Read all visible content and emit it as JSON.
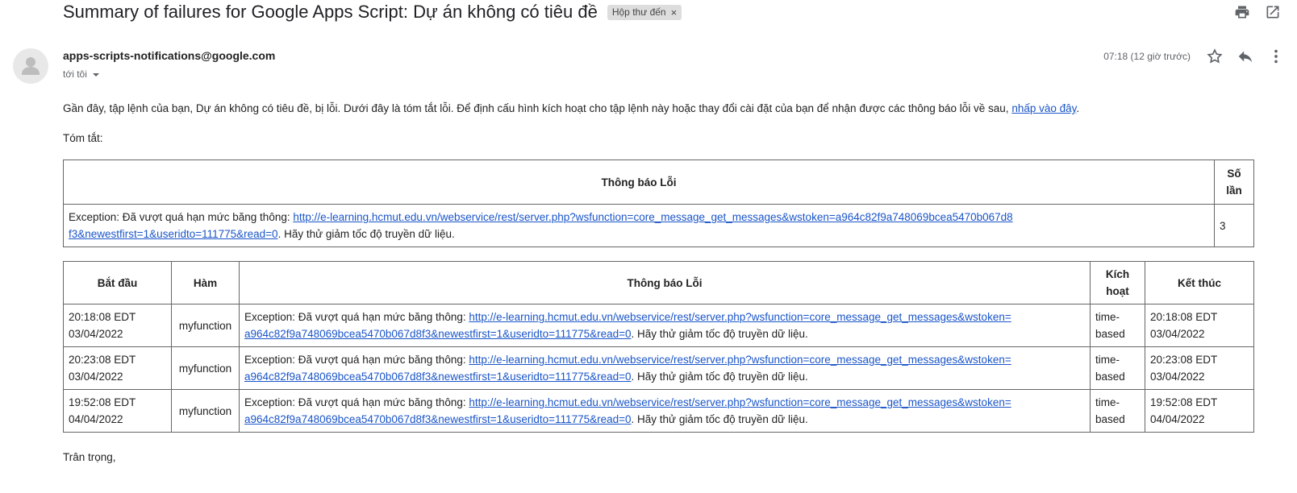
{
  "email": {
    "subject": "Summary of failures for Google Apps Script: Dự án không có tiêu đề",
    "label": "Hộp thư đến",
    "label_remove": "×",
    "sender": "apps-scripts-notifications@google.com",
    "recipient": "tới tôi",
    "time": "07:18 (12 giờ trước)",
    "icons": {
      "print": "print-icon",
      "new_window": "open-in-new-window-icon",
      "star": "star-icon",
      "reply": "reply-icon",
      "more": "more-vert-icon",
      "avatar": "person-icon"
    }
  },
  "body": {
    "intro_text": "Gần đây, tập lệnh của bạn, Dự án không có tiêu đề, bị lỗi. Dưới đây là tóm tắt lỗi. Để định cấu hình kích hoạt cho tập lệnh này hoặc thay đổi cài đặt của bạn để nhận được các thông báo lỗi về sau, ",
    "intro_link": "nhấp vào đây",
    "intro_end": ".",
    "summary_label": "Tóm tắt:",
    "closing": "Trân trọng,"
  },
  "summary_table": {
    "headers": {
      "message": "Thông báo Lỗi",
      "count": "Số lần"
    },
    "rows": [
      {
        "message_prefix": "Exception: Đã vượt quá hạn mức băng thông: ",
        "url_line1": "http://e-learning.hcmut.edu.vn/webservice/rest/server.php?wsfunction=core_message_get_messages&wstoken=a964c82f9a748069bcea5470b067d8",
        "url_line2": "f3&newestfirst=1&useridto=111775&read=0",
        "message_suffix": ". Hãy thử giảm tốc độ truyền dữ liệu.",
        "count": "3"
      }
    ]
  },
  "detail_table": {
    "headers": {
      "start": "Bắt đầu",
      "function": "Hàm",
      "message": "Thông báo Lỗi",
      "trigger": "Kích hoạt",
      "end": "Kết thúc"
    },
    "rows": [
      {
        "start": "20:18:08 EDT 03/04/2022",
        "function": "myfunction",
        "message_prefix": "Exception: Đã vượt quá hạn mức băng thông: ",
        "url_line1": "http://e-learning.hcmut.edu.vn/webservice/rest/server.php?wsfunction=core_message_get_messages&wstoken=",
        "url_line2": "a964c82f9a748069bcea5470b067d8f3&newestfirst=1&useridto=111775&read=0",
        "message_suffix": ". Hãy thử giảm tốc độ truyền dữ liệu.",
        "trigger": "time-based",
        "end": "20:18:08 EDT 03/04/2022"
      },
      {
        "start": "20:23:08 EDT 03/04/2022",
        "function": "myfunction",
        "message_prefix": "Exception: Đã vượt quá hạn mức băng thông: ",
        "url_line1": "http://e-learning.hcmut.edu.vn/webservice/rest/server.php?wsfunction=core_message_get_messages&wstoken=",
        "url_line2": "a964c82f9a748069bcea5470b067d8f3&newestfirst=1&useridto=111775&read=0",
        "message_suffix": ". Hãy thử giảm tốc độ truyền dữ liệu.",
        "trigger": "time-based",
        "end": "20:23:08 EDT 03/04/2022"
      },
      {
        "start": "19:52:08 EDT 04/04/2022",
        "function": "myfunction",
        "message_prefix": "Exception: Đã vượt quá hạn mức băng thông: ",
        "url_line1": "http://e-learning.hcmut.edu.vn/webservice/rest/server.php?wsfunction=core_message_get_messages&wstoken=",
        "url_line2": "a964c82f9a748069bcea5470b067d8f3&newestfirst=1&useridto=111775&read=0",
        "message_suffix": ". Hãy thử giảm tốc độ truyền dữ liệu.",
        "trigger": "time-based",
        "end": "19:52:08 EDT 04/04/2022"
      }
    ]
  }
}
